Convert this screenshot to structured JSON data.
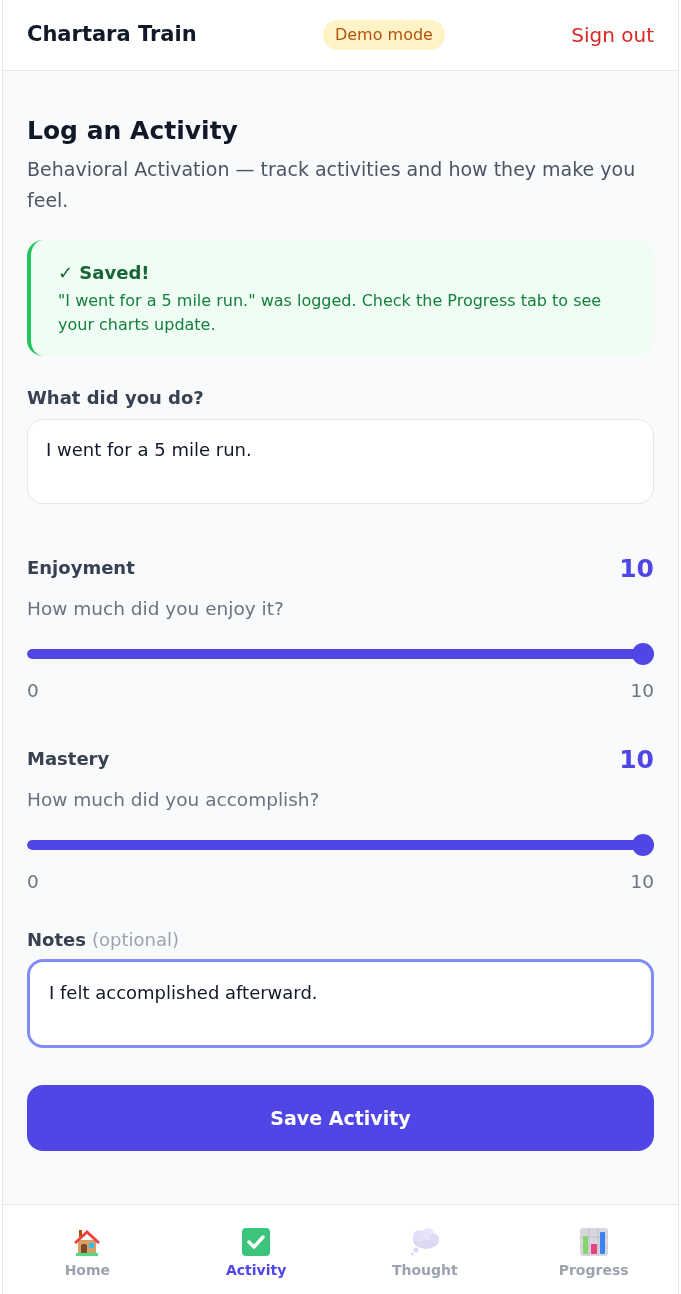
{
  "header": {
    "title": "Chartara Train",
    "badge": "Demo mode",
    "sign_out": "Sign out"
  },
  "page": {
    "title": "Log an Activity",
    "subtitle": "Behavioral Activation — track activities and how they make you feel."
  },
  "alert": {
    "title": "✓ Saved!",
    "message": "\"I went for a 5 mile run.\" was logged. Check the Progress tab to see your charts update."
  },
  "activity_field": {
    "label": "What did you do?",
    "value": "I went for a 5 mile run."
  },
  "sliders": [
    {
      "label": "Enjoyment",
      "reading": "10",
      "hint": "How much did you enjoy it?",
      "level": 1,
      "min_label": "0",
      "max_label": "10"
    },
    {
      "label": "Mastery",
      "reading": "10",
      "hint": "How much did you accomplish?",
      "level": 1,
      "min_label": "0",
      "max_label": "10"
    }
  ],
  "notes": {
    "label": "Notes",
    "label_hint": "(optional)",
    "value": "I felt accomplished afterward.",
    "focused": true
  },
  "save_button": "Save Activity",
  "nav": [
    {
      "label": "Home",
      "kind": "home",
      "selected": false
    },
    {
      "label": "Activity",
      "kind": "activity",
      "selected": true
    },
    {
      "label": "Thought",
      "kind": "thought",
      "selected": false
    },
    {
      "label": "Progress",
      "kind": "progress",
      "selected": false
    }
  ]
}
